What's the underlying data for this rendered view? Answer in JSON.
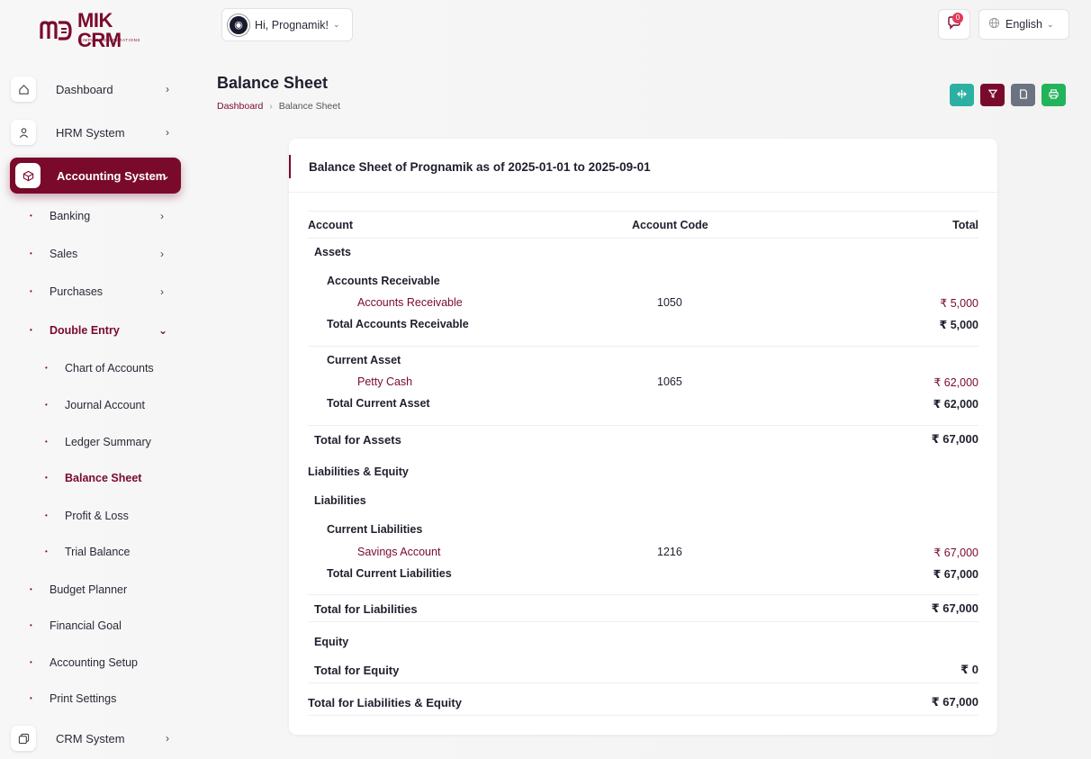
{
  "brand": {
    "name": "MIK CRM",
    "tagline": "SIMPLIFIED OPERATIONS"
  },
  "header": {
    "greeting": "Hi, Prognamik!",
    "notifications_count": "0",
    "language": "English"
  },
  "sidebar": {
    "top": [
      {
        "label": "Dashboard"
      },
      {
        "label": "HRM System"
      },
      {
        "label": "Accounting System"
      },
      {
        "label": "CRM System"
      }
    ],
    "sub": [
      {
        "label": "Banking"
      },
      {
        "label": "Sales"
      },
      {
        "label": "Purchases"
      },
      {
        "label": "Double Entry"
      },
      {
        "label": "Chart of Accounts"
      },
      {
        "label": "Journal Account"
      },
      {
        "label": "Ledger Summary"
      },
      {
        "label": "Balance Sheet"
      },
      {
        "label": "Profit & Loss"
      },
      {
        "label": "Trial Balance"
      },
      {
        "label": "Budget Planner"
      },
      {
        "label": "Financial Goal"
      },
      {
        "label": "Accounting Setup"
      },
      {
        "label": "Print Settings"
      }
    ]
  },
  "page": {
    "title": "Balance Sheet",
    "breadcrumb": [
      "Dashboard",
      "Balance Sheet"
    ]
  },
  "colors": {
    "accent": "#7a0a2c",
    "teal": "#2bb0a2",
    "gray": "#6c7380",
    "green": "#22b35b"
  },
  "actions": [
    {
      "icon": "export-icon",
      "color": "#2bb0a2"
    },
    {
      "icon": "filter-icon",
      "color": "#7a0a2c"
    },
    {
      "icon": "file-icon",
      "color": "#6c7380"
    },
    {
      "icon": "print-icon",
      "color": "#22b35b"
    }
  ],
  "report": {
    "heading": "Balance Sheet of Prognamik as of 2025-01-01 to 2025-09-01",
    "columns": {
      "account": "Account",
      "code": "Account Code",
      "total": "Total"
    },
    "rows": [
      {
        "account": "Assets",
        "code": "",
        "total": ""
      },
      {
        "account": "Accounts Receivable",
        "code": "",
        "total": ""
      },
      {
        "account": "Accounts Receivable",
        "code": "1050",
        "total": "₹ 5,000"
      },
      {
        "account": "Total Accounts Receivable",
        "code": "",
        "total": "₹ 5,000"
      },
      {
        "account": "Current Asset",
        "code": "",
        "total": ""
      },
      {
        "account": "Petty Cash",
        "code": "1065",
        "total": "₹ 62,000"
      },
      {
        "account": "Total Current Asset",
        "code": "",
        "total": "₹ 62,000"
      },
      {
        "account": "Total for Assets",
        "code": "",
        "total": "₹ 67,000"
      },
      {
        "account": "Liabilities & Equity",
        "code": "",
        "total": ""
      },
      {
        "account": "Liabilities",
        "code": "",
        "total": ""
      },
      {
        "account": "Current Liabilities",
        "code": "",
        "total": ""
      },
      {
        "account": "Savings Account",
        "code": "1216",
        "total": "₹ 67,000"
      },
      {
        "account": "Total Current Liabilities",
        "code": "",
        "total": "₹ 67,000"
      },
      {
        "account": "Total for Liabilities",
        "code": "",
        "total": "₹ 67,000"
      },
      {
        "account": "Equity",
        "code": "",
        "total": ""
      },
      {
        "account": "Total for Equity",
        "code": "",
        "total": "₹ 0"
      },
      {
        "account": "Total for Liabilities & Equity",
        "code": "",
        "total": "₹ 67,000"
      }
    ]
  }
}
